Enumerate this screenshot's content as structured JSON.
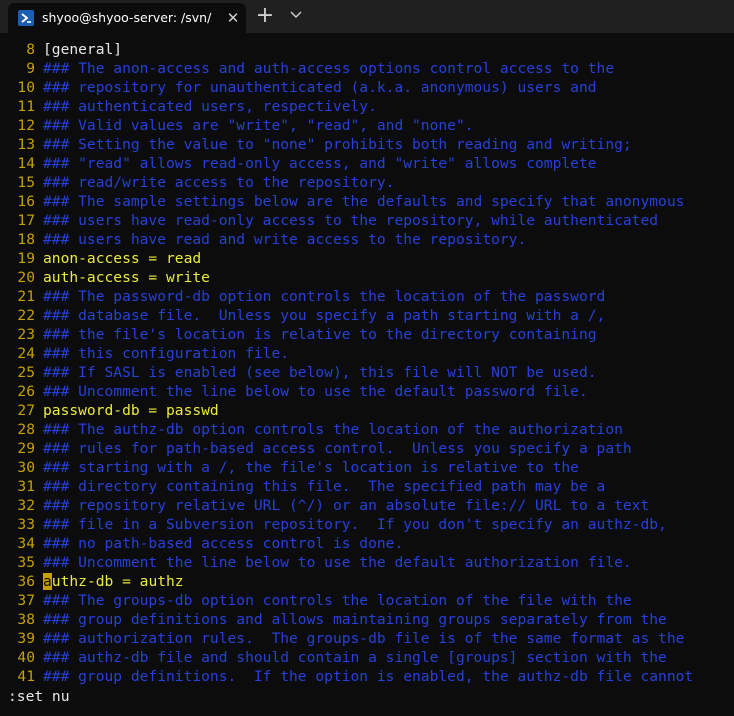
{
  "window": {
    "tab_title": "shyoo@shyoo-server: /svn/svn",
    "close_glyph": "✕",
    "new_tab_glyph": "+",
    "icon": "powershell-terminal-icon"
  },
  "editor": {
    "lines": [
      {
        "num": "8",
        "type": "section",
        "text": "[general]"
      },
      {
        "num": "9",
        "type": "comment",
        "text": "### The anon-access and auth-access options control access to the"
      },
      {
        "num": "10",
        "type": "comment",
        "text": "### repository for unauthenticated (a.k.a. anonymous) users and"
      },
      {
        "num": "11",
        "type": "comment",
        "text": "### authenticated users, respectively."
      },
      {
        "num": "12",
        "type": "comment",
        "text": "### Valid values are \"write\", \"read\", and \"none\"."
      },
      {
        "num": "13",
        "type": "comment",
        "text": "### Setting the value to \"none\" prohibits both reading and writing;"
      },
      {
        "num": "14",
        "type": "comment",
        "text": "### \"read\" allows read-only access, and \"write\" allows complete"
      },
      {
        "num": "15",
        "type": "comment",
        "text": "### read/write access to the repository."
      },
      {
        "num": "16",
        "type": "comment",
        "text": "### The sample settings below are the defaults and specify that anonymous"
      },
      {
        "num": "17",
        "type": "comment",
        "text": "### users have read-only access to the repository, while authenticated"
      },
      {
        "num": "18",
        "type": "comment",
        "text": "### users have read and write access to the repository."
      },
      {
        "num": "19",
        "type": "code",
        "text": "anon-access = read"
      },
      {
        "num": "20",
        "type": "code",
        "text": "auth-access = write"
      },
      {
        "num": "21",
        "type": "comment",
        "text": "### The password-db option controls the location of the password"
      },
      {
        "num": "22",
        "type": "comment",
        "text": "### database file.  Unless you specify a path starting with a /,"
      },
      {
        "num": "23",
        "type": "comment",
        "text": "### the file's location is relative to the directory containing"
      },
      {
        "num": "24",
        "type": "comment",
        "text": "### this configuration file."
      },
      {
        "num": "25",
        "type": "comment",
        "text": "### If SASL is enabled (see below), this file will NOT be used."
      },
      {
        "num": "26",
        "type": "comment",
        "text": "### Uncomment the line below to use the default password file."
      },
      {
        "num": "27",
        "type": "code",
        "text": "password-db = passwd"
      },
      {
        "num": "28",
        "type": "comment",
        "text": "### The authz-db option controls the location of the authorization"
      },
      {
        "num": "29",
        "type": "comment",
        "text": "### rules for path-based access control.  Unless you specify a path"
      },
      {
        "num": "30",
        "type": "comment",
        "text": "### starting with a /, the file's location is relative to the"
      },
      {
        "num": "31",
        "type": "comment",
        "text": "### directory containing this file.  The specified path may be a"
      },
      {
        "num": "32",
        "type": "comment",
        "text": "### repository relative URL (^/) or an absolute file:// URL to a text"
      },
      {
        "num": "33",
        "type": "comment",
        "text": "### file in a Subversion repository.  If you don't specify an authz-db,"
      },
      {
        "num": "34",
        "type": "comment",
        "text": "### no path-based access control is done."
      },
      {
        "num": "35",
        "type": "comment",
        "text": "### Uncomment the line below to use the default authorization file."
      },
      {
        "num": "36",
        "type": "code",
        "text": "authz-db = authz",
        "cursor": true
      },
      {
        "num": "37",
        "type": "comment",
        "text": "### The groups-db option controls the location of the file with the"
      },
      {
        "num": "38",
        "type": "comment",
        "text": "### group definitions and allows maintaining groups separately from the"
      },
      {
        "num": "39",
        "type": "comment",
        "text": "### authorization rules.  The groups-db file is of the same format as the"
      },
      {
        "num": "40",
        "type": "comment",
        "text": "### authz-db file and should contain a single [groups] section with the"
      },
      {
        "num": "41",
        "type": "comment",
        "text": "### group definitions.  If the option is enabled, the authz-db file cannot"
      }
    ],
    "command_line": ":set nu"
  },
  "colors": {
    "background": "#0c0c0c",
    "line_number": "#c4a000",
    "comment": "#2740d8",
    "code": "#ecec3c"
  }
}
